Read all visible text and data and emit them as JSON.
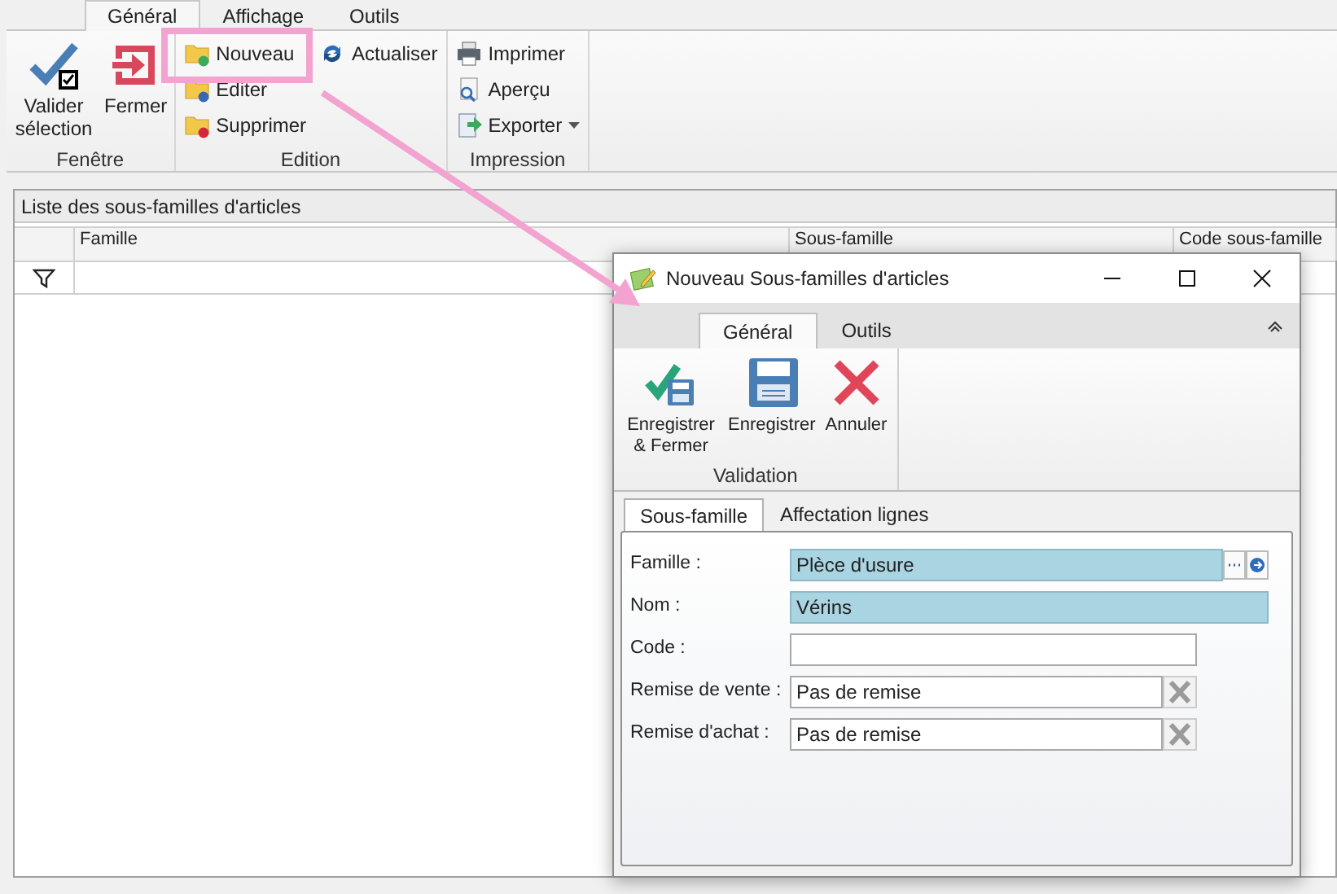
{
  "ribbon": {
    "tabs": [
      {
        "label": "Général",
        "selected": true
      },
      {
        "label": "Affichage",
        "selected": false
      },
      {
        "label": "Outils",
        "selected": false
      }
    ],
    "groups": [
      {
        "label": "Fenêtre",
        "columns": [
          [
            {
              "kind": "large",
              "label": "Valider sélection"
            }
          ],
          [
            {
              "kind": "large",
              "label": "Fermer"
            }
          ]
        ]
      },
      {
        "label": "Edition",
        "columns": [
          [
            {
              "kind": "small",
              "label": "Nouveau"
            },
            {
              "kind": "small",
              "label": "Editer"
            },
            {
              "kind": "small",
              "label": "Supprimer"
            }
          ],
          [
            {
              "kind": "small",
              "label": "Actualiser"
            }
          ]
        ]
      },
      {
        "label": "Impression",
        "columns": [
          [
            {
              "kind": "small",
              "label": "Imprimer"
            },
            {
              "kind": "small",
              "label": "Aperçu"
            },
            {
              "kind": "small",
              "label": "Exporter",
              "dropdown": true
            }
          ]
        ]
      }
    ]
  },
  "grid": {
    "title": "Liste des sous-familles d'articles",
    "columns": [
      "Famille",
      "Sous-famille",
      "Code sous-famille"
    ]
  },
  "dialog": {
    "title": "Nouveau Sous-familles d'articles",
    "tabs": [
      {
        "label": "Général",
        "selected": true
      },
      {
        "label": "Outils",
        "selected": false
      }
    ],
    "group": {
      "label": "Validation",
      "buttons": [
        "Enregistrer & Fermer",
        "Enregistrer",
        "Annuler"
      ]
    },
    "page_tabs": [
      {
        "label": "Sous-famille",
        "selected": true
      },
      {
        "label": "Affectation lignes",
        "selected": false
      }
    ],
    "fields": [
      {
        "kind": "lookup",
        "label": "Famille :",
        "value": "Plèce d'usure",
        "required": true
      },
      {
        "kind": "text",
        "label": "Nom :",
        "value": "Vérins",
        "required": true
      },
      {
        "kind": "short",
        "label": "Code :",
        "required": false
      },
      {
        "kind": "clearable",
        "label": "Remise de vente :",
        "value": "Pas de remise",
        "required": false
      },
      {
        "kind": "clearable",
        "label": "Remise d'achat :",
        "value": "Pas de remise",
        "required": false
      }
    ]
  }
}
